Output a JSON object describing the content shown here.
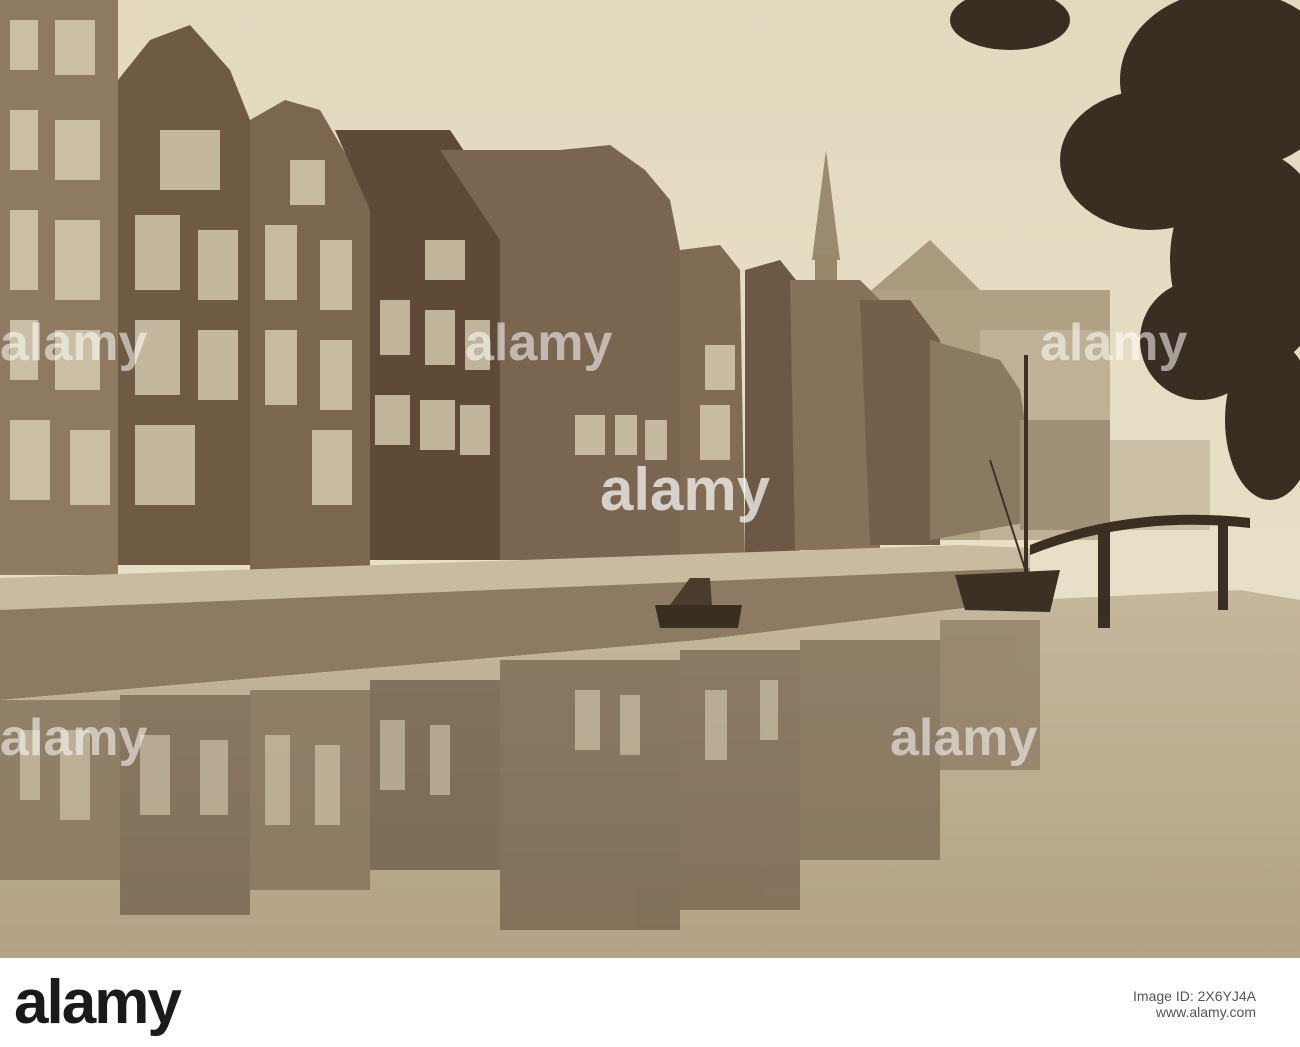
{
  "photo": {
    "watermark_text": "alamy",
    "palette": {
      "sky": "#e8dfc6",
      "building_dark": "#6e5a45",
      "building_mid": "#8a7559",
      "quay": "#a6937a",
      "water": "#b8a88c",
      "foliage": "#3e3125"
    }
  },
  "footer": {
    "logo": "alamy",
    "image_id_label": "Image ID: 2X6YJ4A",
    "image_id": "2X6YJ4A",
    "url": "www.alamy.com"
  }
}
